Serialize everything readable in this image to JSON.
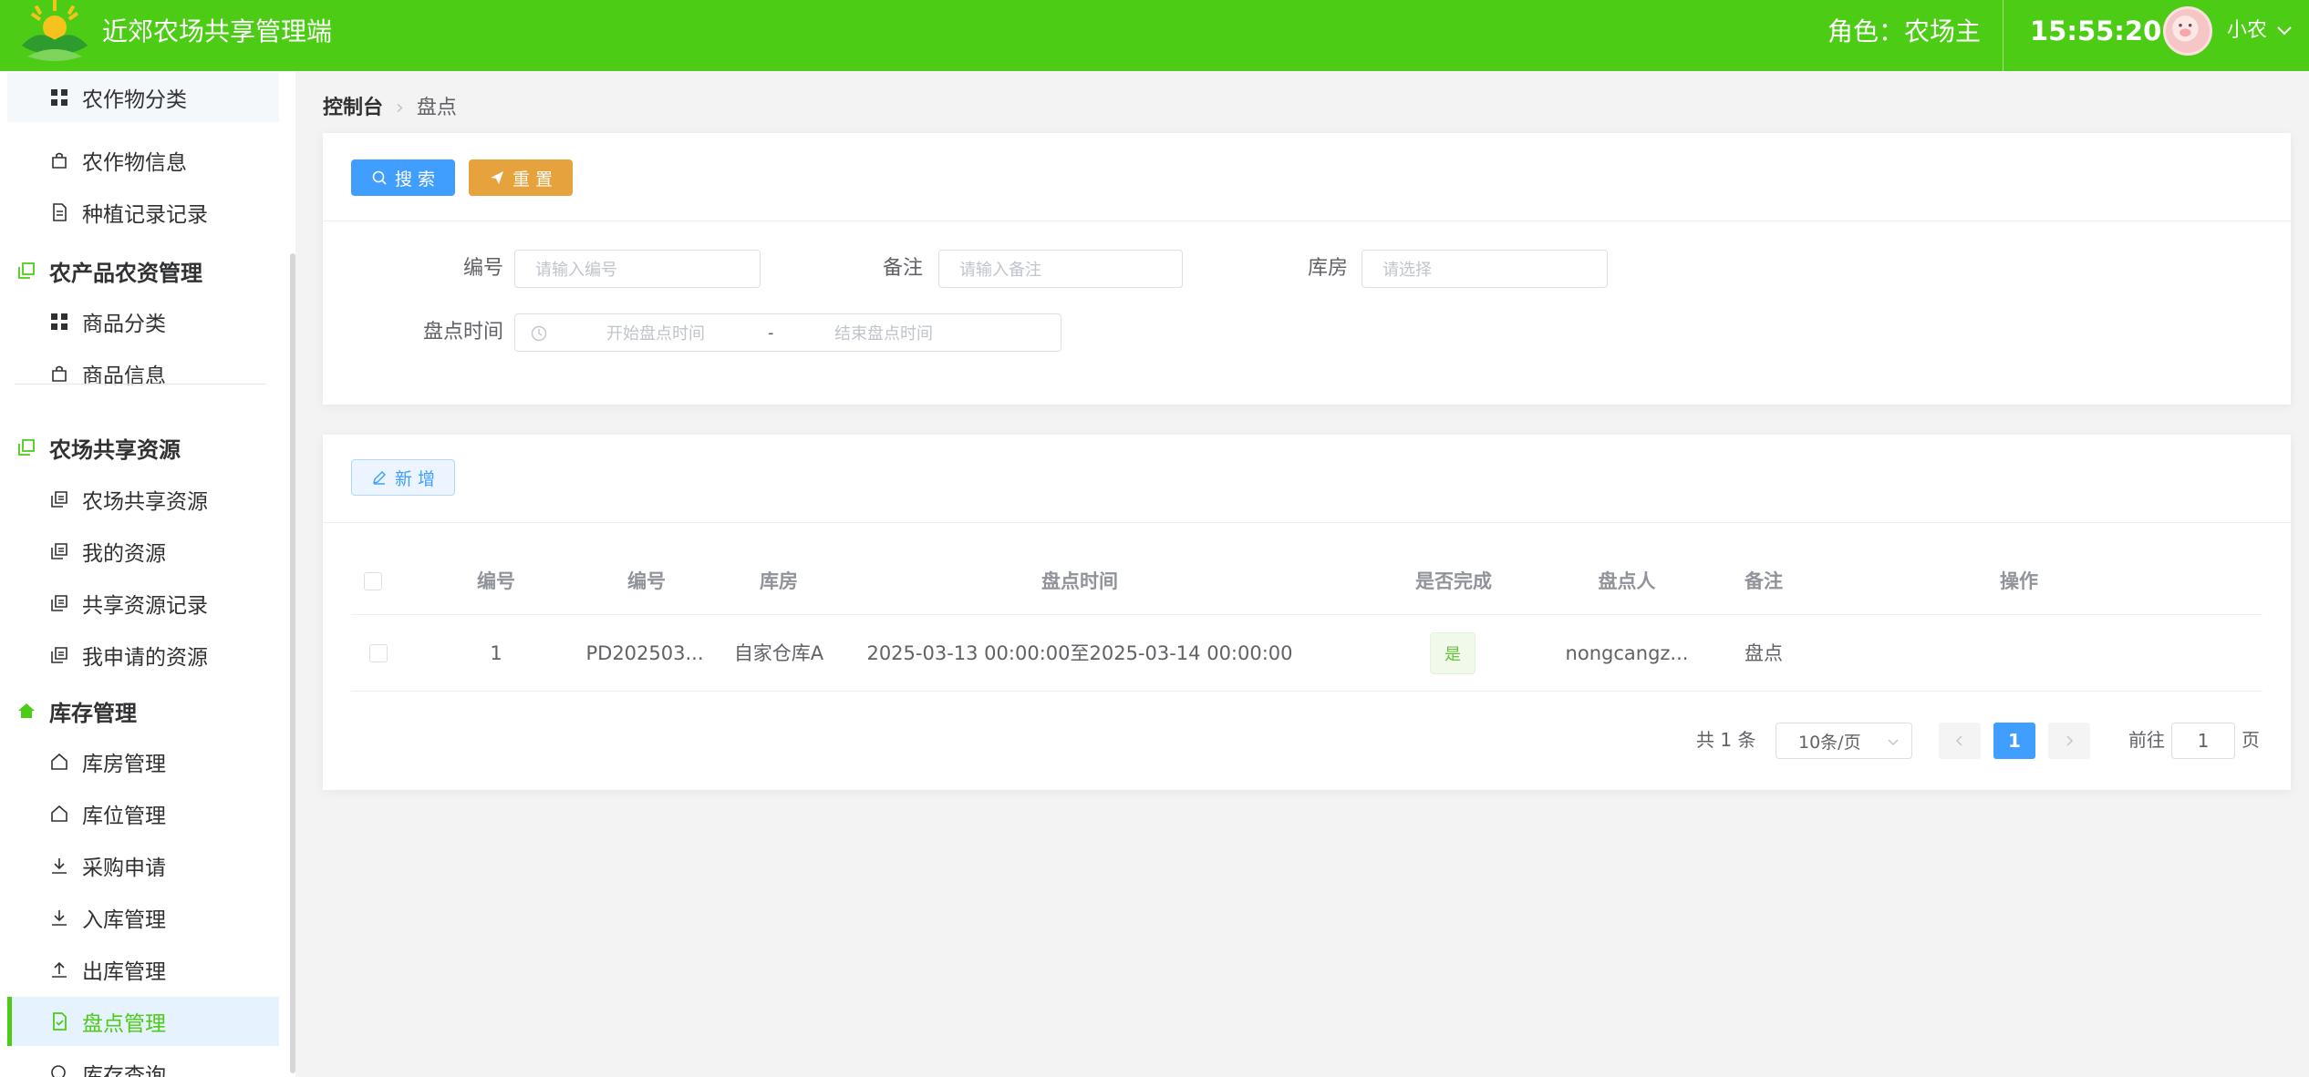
{
  "header": {
    "title": "近郊农场共享管理端",
    "role": "角色：农场主",
    "time": "15:55:20",
    "user_name": "小农",
    "accent_color": "#4ccc15"
  },
  "sidebar": {
    "items": [
      {
        "label": "农作物分类",
        "icon": "grid-icon"
      },
      {
        "label": "农作物信息",
        "icon": "bag-icon"
      },
      {
        "label": "种植记录记录",
        "icon": "document-icon"
      },
      {
        "label": "农产品农资管理",
        "icon": "copy-icon",
        "group": true
      },
      {
        "label": "商品分类",
        "icon": "grid-icon"
      },
      {
        "label": "商品信息",
        "icon": "bag-icon"
      },
      {
        "label": "农场共享资源",
        "icon": "copy-icon",
        "group": true
      },
      {
        "label": "农场共享资源",
        "icon": "copy-icon"
      },
      {
        "label": "我的资源",
        "icon": "copy-icon"
      },
      {
        "label": "共享资源记录",
        "icon": "copy-icon"
      },
      {
        "label": "我申请的资源",
        "icon": "copy-icon"
      },
      {
        "label": "库存管理",
        "icon": "home-icon",
        "group": true
      },
      {
        "label": "库房管理",
        "icon": "house-icon"
      },
      {
        "label": "库位管理",
        "icon": "house-icon"
      },
      {
        "label": "采购申请",
        "icon": "download-icon"
      },
      {
        "label": "入库管理",
        "icon": "download-icon"
      },
      {
        "label": "出库管理",
        "icon": "upload-icon"
      },
      {
        "label": "盘点管理",
        "icon": "doc-check-icon",
        "active": true
      },
      {
        "label": "库存查询",
        "icon": "search-icon"
      }
    ]
  },
  "breadcrumb": {
    "home": "控制台",
    "current": "盘点"
  },
  "search": {
    "search_button": "搜 索",
    "reset_button": "重 置",
    "fields": {
      "code_label": "编号",
      "code_placeholder": "请输入编号",
      "remark_label": "备注",
      "remark_placeholder": "请输入备注",
      "warehouse_label": "库房",
      "warehouse_placeholder": "请选择",
      "time_label": "盘点时间",
      "start_placeholder": "开始盘点时间",
      "range_separator": "-",
      "end_placeholder": "结束盘点时间"
    }
  },
  "table": {
    "add_button": "新 增",
    "columns": [
      "编号",
      "编号",
      "库房",
      "盘点时间",
      "是否完成",
      "盘点人",
      "备注",
      "操作"
    ],
    "rows": [
      {
        "index": "1",
        "code": "PD202503...",
        "warehouse": "自家仓库A",
        "time": "2025-03-13 00:00:00至2025-03-14 00:00:00",
        "done": "是",
        "operator": "nongcangz...",
        "remark": "盘点"
      }
    ]
  },
  "pagination": {
    "total": "共 1 条",
    "page_size": "10条/页",
    "current_page": "1",
    "goto_label": "前往",
    "goto_value": "1",
    "page_suffix": "页"
  }
}
